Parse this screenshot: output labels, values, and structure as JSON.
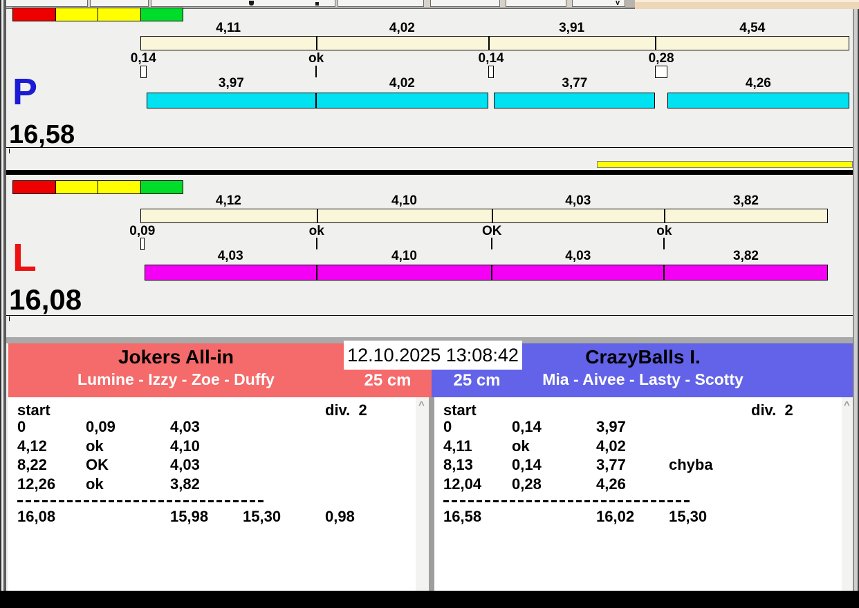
{
  "window": {
    "background_toolbar": {
      "peach_color": "#eed6b9"
    }
  },
  "clock": "12.10.2025 13:08:42",
  "lanes": [
    {
      "letter": "P",
      "letter_color": "#1b1bd3",
      "total": "16,58",
      "lights": [
        "#ee0000",
        "#ffff00",
        "#ffff00",
        "#00dc2a"
      ],
      "split_times": [
        "4,11",
        "4,02",
        "3,91",
        "4,54"
      ],
      "crossings": [
        "0,14",
        "ok",
        "0,14",
        "0,28"
      ],
      "leg_times": [
        "3,97",
        "4,02",
        "3,77",
        "4,26"
      ],
      "split_bar_color": "#faf6da",
      "leg_bar_color": "#00e1f1",
      "progress_bar": true,
      "progress_color": "#ffff00"
    },
    {
      "letter": "L",
      "letter_color": "#ee1111",
      "total": "16,08",
      "lights": [
        "#ee0000",
        "#ffff00",
        "#ffff00",
        "#00dc2a"
      ],
      "split_times": [
        "4,12",
        "4,10",
        "4,03",
        "3,82"
      ],
      "crossings": [
        "0,09",
        "ok",
        "OK",
        "ok"
      ],
      "leg_times": [
        "4,03",
        "4,10",
        "4,03",
        "3,82"
      ],
      "split_bar_color": "#faf6da",
      "leg_bar_color": "#f400f4",
      "progress_bar": false,
      "progress_color": "#ffff00"
    }
  ],
  "teams": [
    {
      "name": "Jokers All-in",
      "members": "Lumine - Izzy - Zoe - Duffy",
      "category": "25 cm",
      "color": "#f56a6a",
      "table": {
        "corner": "start",
        "division": "div.  2",
        "rows": [
          [
            "0",
            "0,09",
            "4,03",
            ""
          ],
          [
            "4,12",
            "ok",
            "4,10",
            ""
          ],
          [
            "8,22",
            "OK",
            "4,03",
            ""
          ],
          [
            "12,26",
            "ok",
            "3,82",
            ""
          ]
        ],
        "totals": [
          "16,08",
          "15,98",
          "15,30",
          "0,98"
        ]
      }
    },
    {
      "name": "CrazyBalls I.",
      "members": "Mia - Aivee - Lasty - Scotty",
      "category": "25 cm",
      "color": "#6263e8",
      "table": {
        "corner": "start",
        "division": "div.  2",
        "rows": [
          [
            "0",
            "0,14",
            "3,97",
            ""
          ],
          [
            "4,11",
            "ok",
            "4,02",
            ""
          ],
          [
            "8,13",
            "0,14",
            "3,77",
            "chyba"
          ],
          [
            "12,04",
            "0,28",
            "4,26",
            ""
          ]
        ],
        "totals": [
          "16,58",
          "16,02",
          "15,30",
          ""
        ]
      }
    }
  ]
}
